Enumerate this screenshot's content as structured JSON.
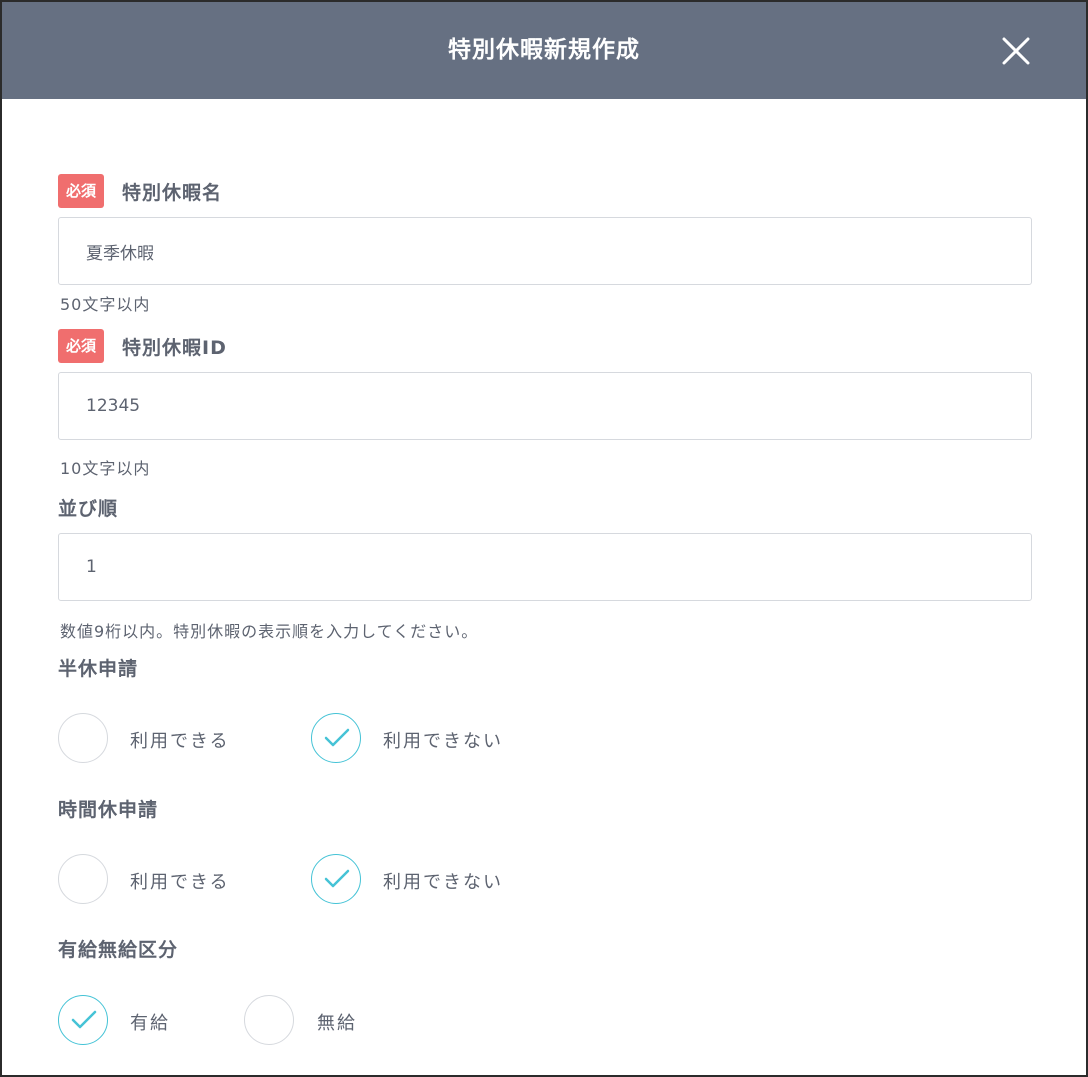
{
  "modal": {
    "title": "特別休暇新規作成",
    "close_icon": "close-icon"
  },
  "fields": {
    "name": {
      "required_badge": "必須",
      "label": "特別休暇名",
      "value": "夏季休暇",
      "hint": "50文字以内"
    },
    "id": {
      "required_badge": "必須",
      "label": "特別休暇ID",
      "value": "12345",
      "hint": "10文字以内"
    },
    "order": {
      "label": "並び順",
      "value": "1",
      "hint": "数値9桁以内。特別休暇の表示順を入力してください。"
    }
  },
  "radio_groups": {
    "half_day": {
      "label": "半休申請",
      "options": [
        "利用できる",
        "利用できない"
      ],
      "selected": "利用できない"
    },
    "hourly": {
      "label": "時間休申請",
      "options": [
        "利用できる",
        "利用できない"
      ],
      "selected": "利用できない"
    },
    "paid": {
      "label": "有給無給区分",
      "options": [
        "有給",
        "無給"
      ],
      "selected": "有給"
    }
  },
  "colors": {
    "header_bg": "#667082",
    "required_badge": "#f06e6e",
    "checked_accent": "#45c3d6",
    "border": "#d6d9de"
  }
}
